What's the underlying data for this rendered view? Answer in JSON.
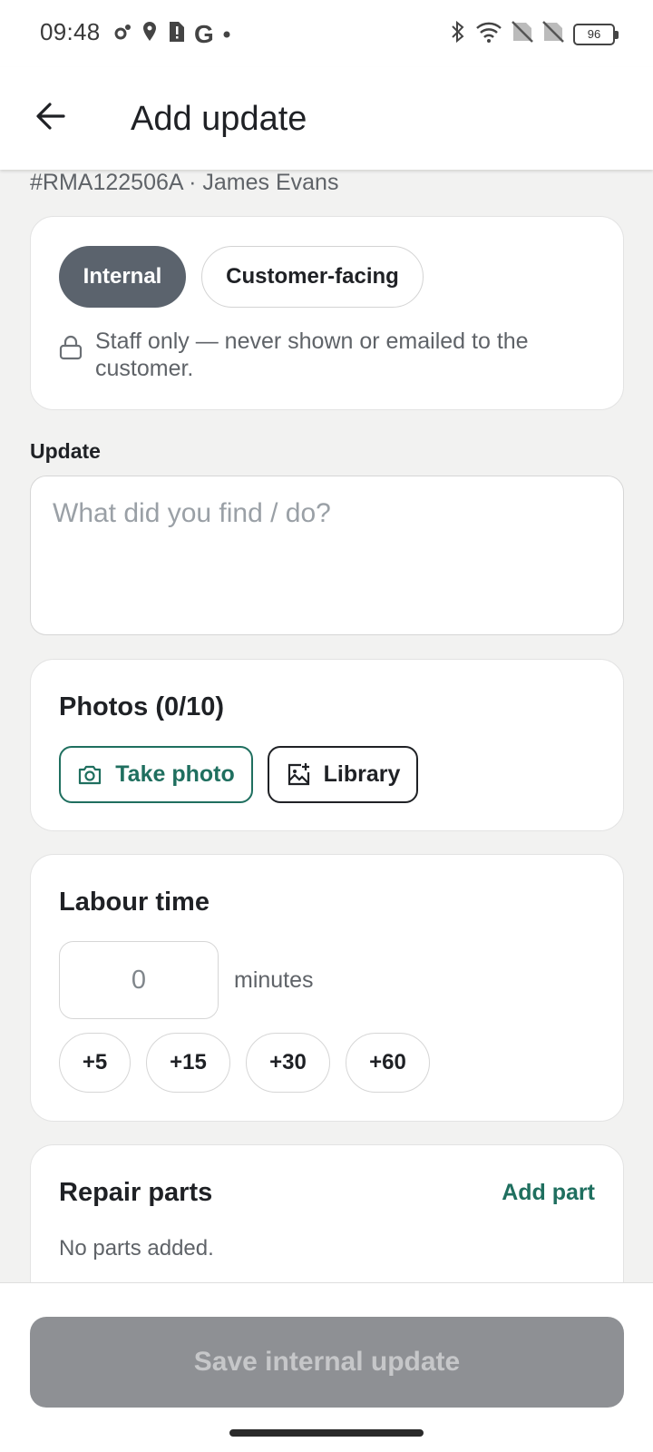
{
  "status_bar": {
    "time": "09:48",
    "battery": "96",
    "left_icons": [
      "settings-icon",
      "location-icon",
      "sim-alert-icon",
      "google-icon",
      "dot-icon"
    ],
    "right_icons": [
      "bluetooth-icon",
      "wifi-icon",
      "no-sim-icon",
      "no-sim-icon",
      "battery-icon"
    ]
  },
  "header": {
    "title": "Add update",
    "back_icon": "arrow-left-icon"
  },
  "subtitle": "#RMA122506A · James Evans",
  "visibility": {
    "options": [
      "Internal",
      "Customer-facing"
    ],
    "selected": "Internal",
    "note": "Staff only — never shown or emailed to the customer.",
    "note_icon": "lock-icon"
  },
  "update": {
    "label": "Update",
    "placeholder": "What did you find / do?",
    "value": ""
  },
  "photos": {
    "title": "Photos (0/10)",
    "take_photo": "Take photo",
    "library": "Library"
  },
  "labour": {
    "title": "Labour time",
    "value": "0",
    "unit": "minutes",
    "increments": [
      "+5",
      "+15",
      "+30",
      "+60"
    ]
  },
  "parts": {
    "title": "Repair parts",
    "add_label": "Add part",
    "empty_text": "No parts added."
  },
  "footer": {
    "save_label": "Save internal update"
  },
  "colors": {
    "accent": "#1f6f5f",
    "selected_pill": "#5b636d",
    "disabled_button": "#8e9094",
    "background": "#f2f2f1"
  }
}
